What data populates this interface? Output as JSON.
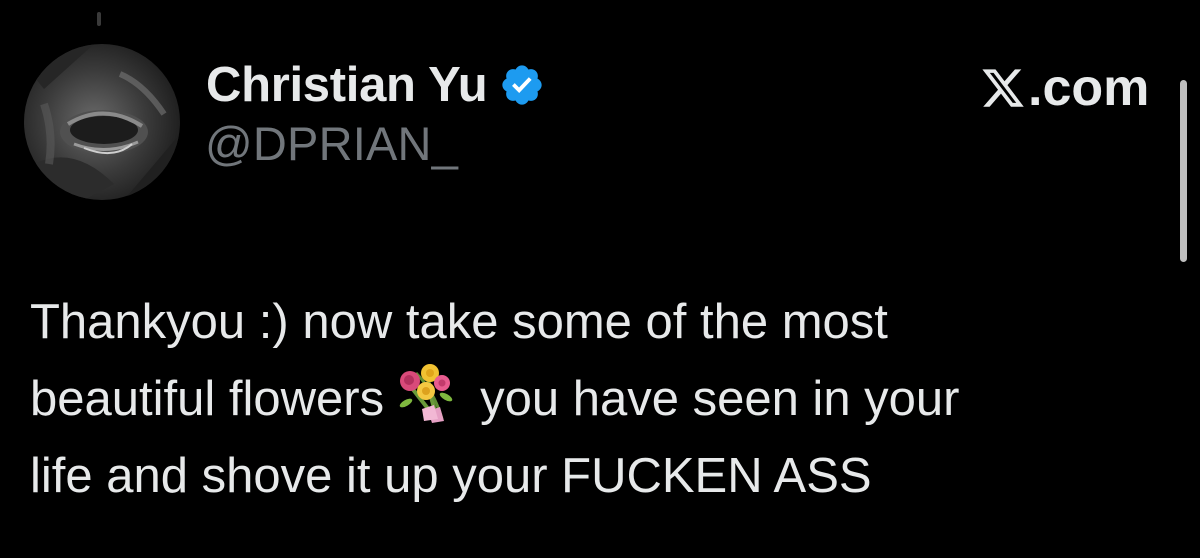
{
  "author": {
    "display_name": "Christian Yu",
    "handle": "@DPRIAN_",
    "verified_icon": "verified-badge-icon",
    "avatar_icon": "avatar-image"
  },
  "brand": {
    "icon": "x-logo-icon",
    "text": ".com"
  },
  "tweet": {
    "line1": "Thankyou :) now take some of the most",
    "line2_before": "beautiful flowers",
    "emoji": "💐",
    "emoji_icon": "bouquet-emoji-icon",
    "line2_after": "you have seen in your",
    "line3": "life and shove it up your FUCKEN ASS"
  },
  "colors": {
    "background": "#000000",
    "text_primary": "#e7e9ea",
    "text_secondary": "#71767b",
    "verified_blue": "#1d9bf0"
  }
}
